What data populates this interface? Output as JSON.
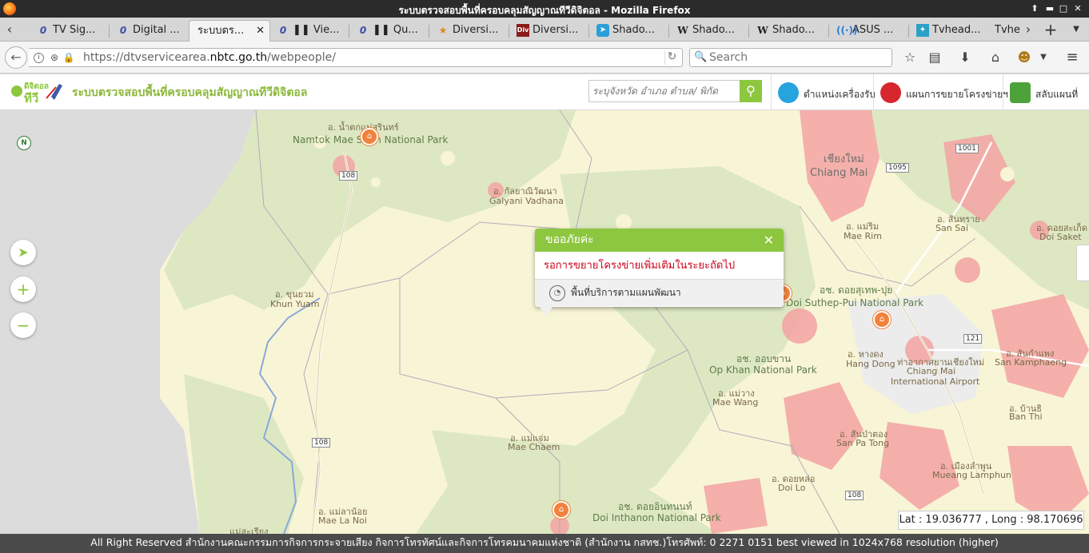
{
  "window": {
    "title": "ระบบตรวจสอบพื้นที่ครอบคลุมสัญญาณทีวีดิจิตอล - Mozilla Firefox"
  },
  "tabs": [
    {
      "label": "TV Sig...",
      "icon": "opera-icon",
      "active": false
    },
    {
      "label": "Digital ...",
      "icon": "opera-icon",
      "active": false
    },
    {
      "label": "ระบบตร...",
      "icon": "none",
      "active": true
    },
    {
      "label": "❚❚ Vie...",
      "icon": "opera-icon",
      "active": false
    },
    {
      "label": "❚❚ Qu...",
      "icon": "opera-icon",
      "active": false
    },
    {
      "label": "Diversi...",
      "icon": "sticker-icon",
      "active": false
    },
    {
      "label": "Diversi...",
      "icon": "div-icon",
      "active": false
    },
    {
      "label": "Shado...",
      "icon": "telegram-icon",
      "active": false
    },
    {
      "label": "Shado...",
      "icon": "wikipedia-icon",
      "active": false
    },
    {
      "label": "Shado...",
      "icon": "wikipedia-icon",
      "active": false
    },
    {
      "label": "ASUS ...",
      "icon": "wifi-icon",
      "active": false
    },
    {
      "label": "Tvhead...",
      "icon": "tvheadend-icon",
      "active": false
    },
    {
      "label": "Tvhe",
      "icon": "none",
      "active": false
    }
  ],
  "tab_div_text": "Div",
  "tab_w_text": "W",
  "navbar": {
    "url_prefix": "https://dtvservicearea.",
    "url_domain": "nbtc.go.th",
    "url_suffix": "/webpeople/",
    "search_placeholder": "Search"
  },
  "site": {
    "title": "ระบบตรวจสอบพื้นที่ครอบคลุมสัญญาณทีวีดิจิตอล",
    "logo_text_top": "ดิจิตอล",
    "logo_text_bottom": "ทีวี",
    "search_placeholder": "ระบุจังหวัด อำเภอ ตำบล/ พิกัด",
    "buttons": [
      {
        "label": "ตำแหน่งเครื่องรับ",
        "icon": "location-pin-icon",
        "color": "#27a3dd"
      },
      {
        "label": "แผนการขยายโครงข่ายฯ",
        "icon": "signal-tower-icon",
        "color": "#d6262e"
      },
      {
        "label": "สลับแผนที่",
        "icon": "map-switch-icon",
        "color": "#4da23a"
      }
    ]
  },
  "map": {
    "north_label": "N",
    "labels": [
      {
        "text": "อ. น้ำตกแม่สุรินทร์",
        "cls": ""
      },
      {
        "text": "Namtok Mae Surin National Park",
        "cls": "green"
      },
      {
        "text": "อ. กัลยาณิวัฒนา",
        "cls": ""
      },
      {
        "text": "Galyani Vadhana",
        "cls": ""
      },
      {
        "text": "เชียงใหม่",
        "cls": "big"
      },
      {
        "text": "Chiang Mai",
        "cls": "big"
      },
      {
        "text": "อ. แม่ริม",
        "cls": ""
      },
      {
        "text": "Mae Rim",
        "cls": ""
      },
      {
        "text": "อ. สันทราย",
        "cls": ""
      },
      {
        "text": "San Sai",
        "cls": ""
      },
      {
        "text": "อ. ดอยสะเก็ด",
        "cls": ""
      },
      {
        "text": "Doi Saket",
        "cls": ""
      },
      {
        "text": "อ. ขุนยวม",
        "cls": ""
      },
      {
        "text": "Khun Yuam",
        "cls": ""
      },
      {
        "text": "อช. ดอยสุเทพ-ปุย",
        "cls": "green"
      },
      {
        "text": "Doi Suthep-Pui National Park",
        "cls": "green"
      },
      {
        "text": "อ. หางดง",
        "cls": ""
      },
      {
        "text": "Hang Dong",
        "cls": ""
      },
      {
        "text": "อ. สันกำแพง",
        "cls": ""
      },
      {
        "text": "San Kamphaeng",
        "cls": ""
      },
      {
        "text": "อช. ออบขาน",
        "cls": "green"
      },
      {
        "text": "Op Khan National Park",
        "cls": "green"
      },
      {
        "text": "ท่าอากาศยานเชียงใหม่",
        "cls": ""
      },
      {
        "text": "Chiang Mai",
        "cls": ""
      },
      {
        "text": "International Airport",
        "cls": ""
      },
      {
        "text": "อ. แม่วาง",
        "cls": ""
      },
      {
        "text": "Mae Wang",
        "cls": ""
      },
      {
        "text": "อ. สันป่าตอง",
        "cls": ""
      },
      {
        "text": "San Pa Tong",
        "cls": ""
      },
      {
        "text": "อ. บ้านธิ",
        "cls": ""
      },
      {
        "text": "Ban Thi",
        "cls": ""
      },
      {
        "text": "อ. แม่แจ่ม",
        "cls": ""
      },
      {
        "text": "Mae Chaem",
        "cls": ""
      },
      {
        "text": "อ. ดอยหล่อ",
        "cls": ""
      },
      {
        "text": "Doi Lo",
        "cls": ""
      },
      {
        "text": "อ. เมืองลำพูน",
        "cls": ""
      },
      {
        "text": "Mueang Lamphun",
        "cls": ""
      },
      {
        "text": "อ. แม่ลาน้อย",
        "cls": ""
      },
      {
        "text": "Mae La Noi",
        "cls": ""
      },
      {
        "text": "อช. ดอยอินทนนท์",
        "cls": "green"
      },
      {
        "text": "Doi Inthanon National Park",
        "cls": "green"
      },
      {
        "text": "แม่สะเรียง",
        "cls": ""
      }
    ],
    "road_labels": [
      "108",
      "108",
      "1001",
      "1095",
      "121",
      "108"
    ],
    "popup": {
      "title": "ขออภัยค่ะ",
      "message": "รอการขยายโครงข่ายเพิ่มเติมในระยะถัดไป",
      "footer": "พื้นที่บริการตามแผนพัฒนา"
    },
    "coords": "Lat : 19.036777 , Long : 98.170696"
  },
  "footer": "All Right Reserved สำนักงานคณะกรรมการกิจการกระจายเสียง กิจการโทรทัศน์และกิจการโทรคมนาคมแห่งชาติ (สำนักงาน กสทช.)โทรศัพท์: 0 2271 0151 best viewed in 1024x768 resolution (higher)",
  "colors": {
    "accent": "#8dc63f",
    "error_text": "#d0021b",
    "footer_bg": "#4b4b4b",
    "map_land": "#f8f5d6",
    "map_forest": "#dde8c3",
    "coverage": "#f4a3a3"
  }
}
